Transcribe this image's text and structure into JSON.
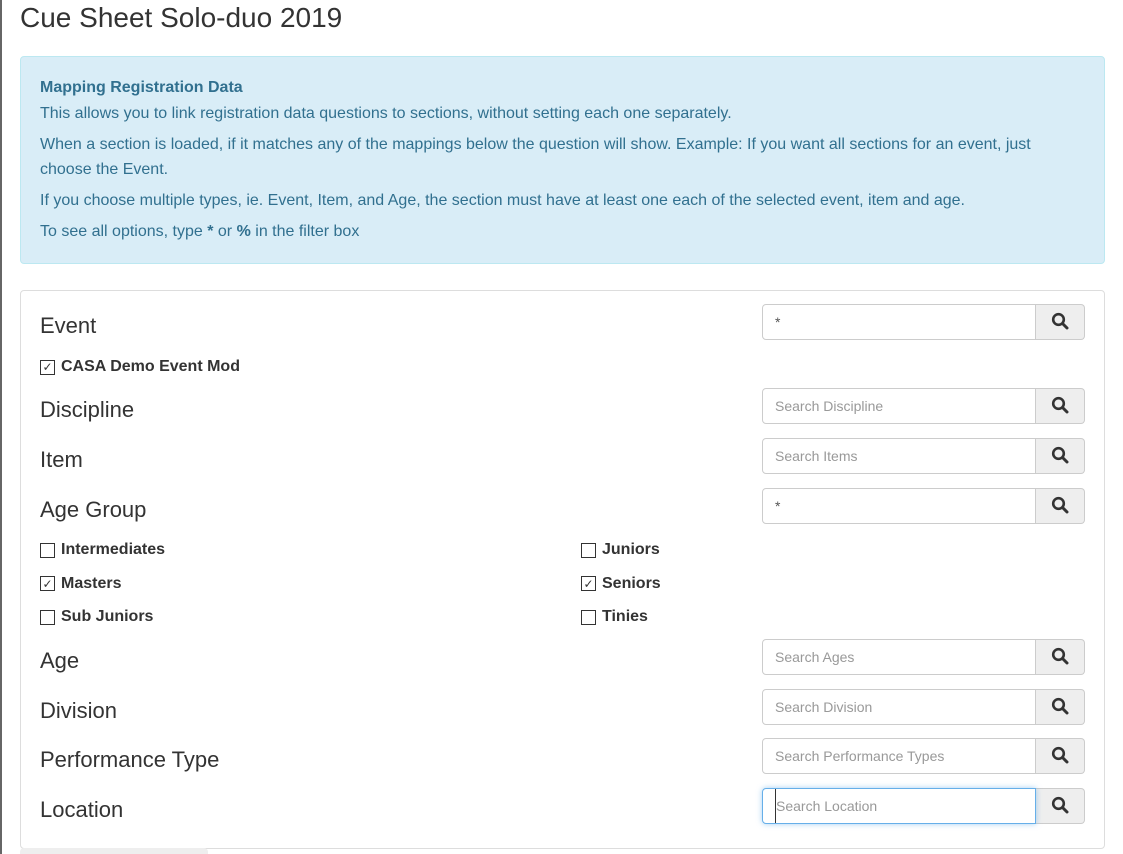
{
  "page_title": "Cue Sheet Solo-duo 2019",
  "alert": {
    "title": "Mapping Registration Data",
    "p1": "This allows you to link registration data questions to sections, without setting each one separately.",
    "p2": "When a section is loaded, if it matches any of the mappings below the question will show. Example: If you want all sections for an event, just choose the Event.",
    "p3": "If you choose multiple types, ie. Event, Item, and Age, the section must have at least one each of the selected event, item and age.",
    "p4_pre": "To see all options, type ",
    "p4_star": "*",
    "p4_mid": " or ",
    "p4_pct": "%",
    "p4_post": " in the filter box"
  },
  "fields": {
    "event": {
      "label": "Event",
      "value": "*",
      "placeholder": ""
    },
    "discipline": {
      "label": "Discipline",
      "value": "",
      "placeholder": "Search Discipline"
    },
    "item": {
      "label": "Item",
      "value": "",
      "placeholder": "Search Items"
    },
    "age_group": {
      "label": "Age Group",
      "value": "*",
      "placeholder": ""
    },
    "age": {
      "label": "Age",
      "value": "",
      "placeholder": "Search Ages"
    },
    "division": {
      "label": "Division",
      "value": "",
      "placeholder": "Search Division"
    },
    "performance_type": {
      "label": "Performance Type",
      "value": "",
      "placeholder": "Search Performance Types"
    },
    "location": {
      "label": "Location",
      "value": "",
      "placeholder": "Search Location"
    }
  },
  "event_options": [
    {
      "label": "CASA Demo Event Mod",
      "checked": true
    }
  ],
  "age_group_options": [
    {
      "label": "Intermediates",
      "checked": false
    },
    {
      "label": "Juniors",
      "checked": false
    },
    {
      "label": "Masters",
      "checked": true
    },
    {
      "label": "Seniors",
      "checked": true
    },
    {
      "label": "Sub Juniors",
      "checked": false
    },
    {
      "label": "Tinies",
      "checked": false
    }
  ],
  "icons": {
    "search": "search-icon",
    "checkbox": "checkbox-icon"
  }
}
